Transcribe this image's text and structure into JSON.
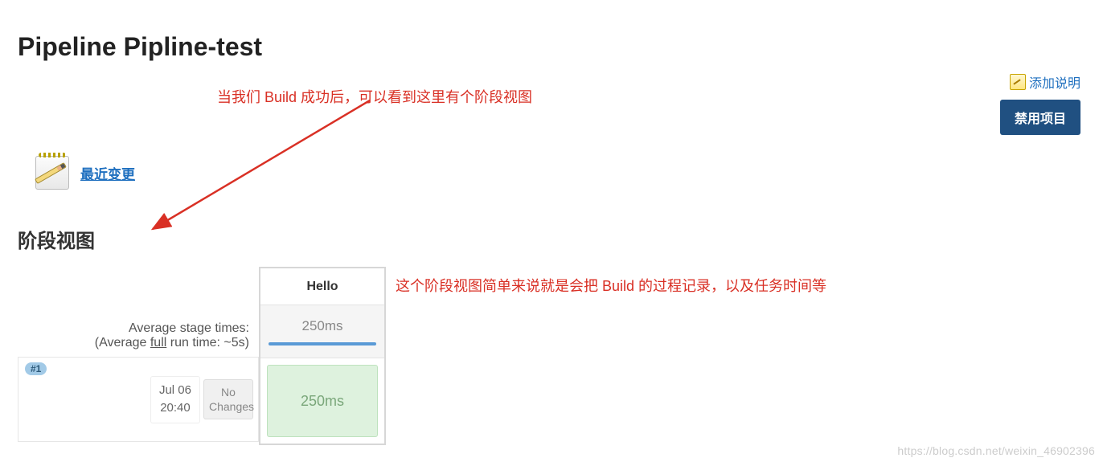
{
  "title": "Pipeline Pipline-test",
  "annotations": {
    "a1": "当我们 Build 成功后，可以看到这里有个阶段视图",
    "a2": "这个阶段视图简单来说就是会把 Build 的过程记录，以及任务时间等"
  },
  "topright": {
    "add_description": "添加说明",
    "disable_project": "禁用项目"
  },
  "recent_changes_label": "最近变更",
  "stage_view_heading": "阶段视图",
  "stage_view": {
    "avg_line1": "Average stage times:",
    "avg_line2_prefix": "(Average ",
    "avg_line2_full": "full",
    "avg_line2_suffix": " run time: ~5s)",
    "stages": [
      {
        "name": "Hello",
        "avg": "250ms"
      }
    ],
    "builds": [
      {
        "badge": "#1",
        "date": "Jul 06",
        "time": "20:40",
        "changes_line1": "No",
        "changes_line2": "Changes",
        "cells": [
          {
            "duration": "250ms",
            "status": "success"
          }
        ]
      }
    ]
  },
  "watermark": "https://blog.csdn.net/weixin_46902396"
}
